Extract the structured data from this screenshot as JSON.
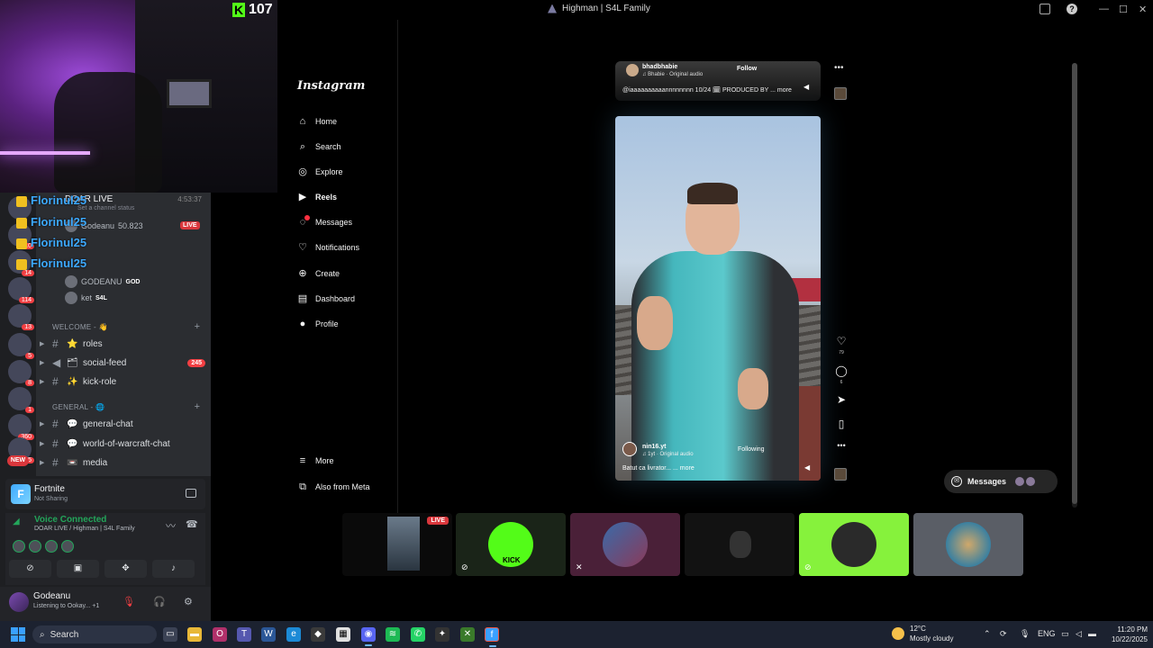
{
  "window": {
    "title": "Highman | S4L Family"
  },
  "stream_overlay": {
    "kick_viewers": "107"
  },
  "discord": {
    "overlay_names": [
      "Florinul25",
      "Florinul25",
      "Florinul25",
      "Florinul25"
    ],
    "voice_channel": {
      "name": "DOAR LIVE",
      "time": "4:53:37",
      "status_placeholder": "Set a channel status",
      "members": [
        {
          "name": "Godeanu",
          "suffix": "50.823",
          "live": "LIVE"
        },
        {
          "name": "GODEANU",
          "tag": "GOD"
        },
        {
          "name": "ket",
          "tag": "S4L"
        }
      ]
    },
    "guild_badges": [
      "10",
      "14",
      "114",
      "13",
      "5",
      "8",
      "1",
      "360",
      "5",
      "NEW"
    ],
    "categories": [
      {
        "label": "WELCOME - 👋",
        "channels": [
          {
            "emoji": "⭐",
            "name": "roles",
            "badge": ""
          },
          {
            "emoji": "🗂",
            "name": "social-feed",
            "badge": "245"
          },
          {
            "emoji": "✨",
            "name": "kick-role",
            "badge": ""
          }
        ]
      },
      {
        "label": "GENERAL - 🌐",
        "channels": [
          {
            "emoji": "💬",
            "name": "general-chat",
            "badge": ""
          },
          {
            "emoji": "💬",
            "name": "world-of-warcraft-chat",
            "badge": ""
          },
          {
            "emoji": "📼",
            "name": "media",
            "badge": ""
          }
        ]
      }
    ],
    "activity": {
      "game": "Fortnite",
      "status": "Not Sharing",
      "icon_letter": "F"
    },
    "voice": {
      "title": "Voice Connected",
      "location": "DOAR LIVE / Highman | S4L Family"
    },
    "user": {
      "name": "Godeanu",
      "status": "Listening to Ookay... +1"
    }
  },
  "instagram": {
    "logo": "Instagram",
    "nav": [
      {
        "icon": "home-icon",
        "label": "Home"
      },
      {
        "icon": "search-icon",
        "label": "Search"
      },
      {
        "icon": "explore-icon",
        "label": "Explore"
      },
      {
        "icon": "reels-icon",
        "label": "Reels"
      },
      {
        "icon": "messages-icon",
        "label": "Messages"
      },
      {
        "icon": "notifications-icon",
        "label": "Notifications"
      },
      {
        "icon": "create-icon",
        "label": "Create"
      },
      {
        "icon": "dashboard-icon",
        "label": "Dashboard"
      },
      {
        "icon": "profile-icon",
        "label": "Profile"
      }
    ],
    "more": "More",
    "also_from_meta": "Also from Meta",
    "reel_top": {
      "author": "bhadbhabie",
      "follow": "Follow",
      "audio": "♫ Bhabie · Original audio",
      "caption": "@iaaaaaaaaaannnnnnnn 10/24 🗓 PRODUCED BY ... more"
    },
    "reel_main": {
      "author": "nin16.yt",
      "audio": "♫ 1yt · Original audio",
      "following": "Following",
      "caption": "Batut ca livrator... ... more"
    },
    "actions": {
      "likes": "79",
      "comments": "6"
    },
    "messages_pill": "Messages"
  },
  "stream_tiles": {
    "live_label": "LIVE",
    "kick_label": "KICK"
  },
  "taskbar": {
    "search": "Search",
    "weather_temp": "12°C",
    "weather_desc": "Mostly cloudy",
    "lang": "ENG",
    "time": "11:20 PM",
    "date": "10/22/2025"
  }
}
